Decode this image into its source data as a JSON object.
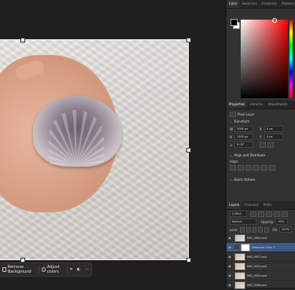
{
  "right_panel": {
    "top_tabs": [
      "Color",
      "Swatches",
      "Gradients",
      "Patterns"
    ],
    "props_tabs": [
      "Properties",
      "Libraries",
      "Adjustments"
    ],
    "layer_type": "Pixel Layer",
    "transform_title": "Transform",
    "w_value": "2000 px",
    "x_value": "0 px",
    "h_value": "1500 px",
    "y_value": "0 px",
    "angle_value": "0.00°",
    "align_title": "Align and Distribute",
    "align_label": "Align:",
    "quick_title": "Quick Actions"
  },
  "layers_panel": {
    "tabs": [
      "Layers",
      "Channels",
      "Paths"
    ],
    "kind": "Q Kind",
    "blend_mode": "Normal",
    "opacity_label": "Opacity:",
    "opacity_value": "42%",
    "lock_label": "Lock:",
    "fill_label": "Fill:",
    "fill_value": "100%",
    "layers": [
      {
        "name": "IMG_9004.psd",
        "selected": false,
        "mask": false
      },
      {
        "name": "Selective Color 1",
        "selected": true,
        "mask": true
      },
      {
        "name": "IMG_9007.psd",
        "selected": false,
        "mask": false
      },
      {
        "name": "IMG_9024.psd",
        "selected": false,
        "mask": false
      },
      {
        "name": "IMG_9020.psd",
        "selected": false,
        "mask": false
      },
      {
        "name": "IMG_9036.psd",
        "selected": false,
        "mask": false
      }
    ]
  },
  "context_bar": {
    "remove_bg": "Remove Background",
    "adjust_colors": "Adjust colors",
    "more": "···"
  },
  "colors": {
    "selection_layer": "#3b5a84",
    "panel_bg": "#323232"
  }
}
